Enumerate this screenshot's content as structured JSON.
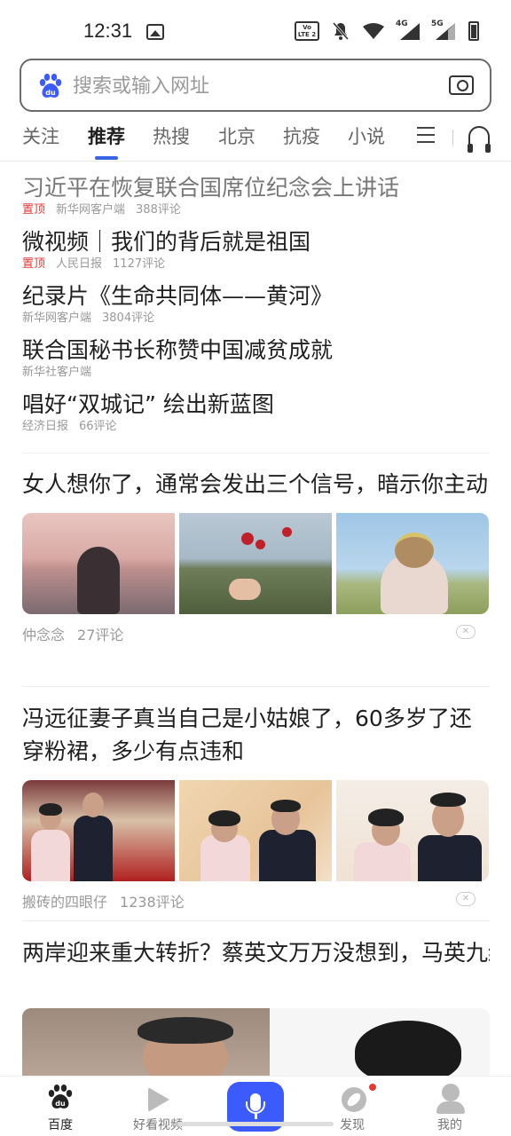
{
  "status_bar": {
    "time": "12:31",
    "volte_label": "Vo LTE 2",
    "cell1_label": "4G",
    "cell2_label": "5G"
  },
  "search": {
    "placeholder": "搜索或输入网址"
  },
  "tabs": [
    {
      "label": "关注"
    },
    {
      "label": "推荐",
      "active": true
    },
    {
      "label": "热搜"
    },
    {
      "label": "北京"
    },
    {
      "label": "抗疫"
    },
    {
      "label": "小说"
    }
  ],
  "top_news": [
    {
      "title": "习近平在恢复联合国席位纪念会上讲话",
      "pin": "置顶",
      "source": "新华网客户端",
      "comments": "388评论",
      "muted": true
    },
    {
      "title": "微视频｜我们的背后就是祖国",
      "pin": "置顶",
      "source": "人民日报",
      "comments": "1127评论"
    },
    {
      "title": "纪录片《生命共同体——黄河》",
      "pin": "",
      "source": "新华网客户端",
      "comments": "3804评论"
    },
    {
      "title": "联合国秘书长称赞中国减贫成就",
      "pin": "",
      "source": "新华社客户端",
      "comments": ""
    },
    {
      "title": "唱好“双城记” 绘出新蓝图",
      "pin": "",
      "source": "经济日报",
      "comments": "66评论"
    }
  ],
  "articles": [
    {
      "title": "女人想你了，通常会发出三个信号，暗示你主动",
      "source": "仲念念",
      "comments": "27评论"
    },
    {
      "title": "冯远征妻子真当自己是小姑娘了，60多岁了还穿粉裙，多少有点违和",
      "source": "搬砖的四眼仔",
      "comments": "1238评论"
    },
    {
      "title": "两岸迎来重大转折？蔡英文万万没想到，马英九终于行动了，“两岸和平统一”响彻岛内..."
    }
  ],
  "close_glyph": "✕",
  "bottom_nav": [
    {
      "label": "百度",
      "icon": "baidu-paw-icon",
      "active": true
    },
    {
      "label": "好看视频",
      "icon": "play-icon"
    },
    {
      "label": "",
      "icon": "microphone-icon"
    },
    {
      "label": "发现",
      "icon": "compass-icon"
    },
    {
      "label": "我的",
      "icon": "user-icon"
    }
  ],
  "colors": {
    "accent": "#3b5bfd",
    "pin_red": "#e53935",
    "tab_underline": "#3b63e8"
  }
}
